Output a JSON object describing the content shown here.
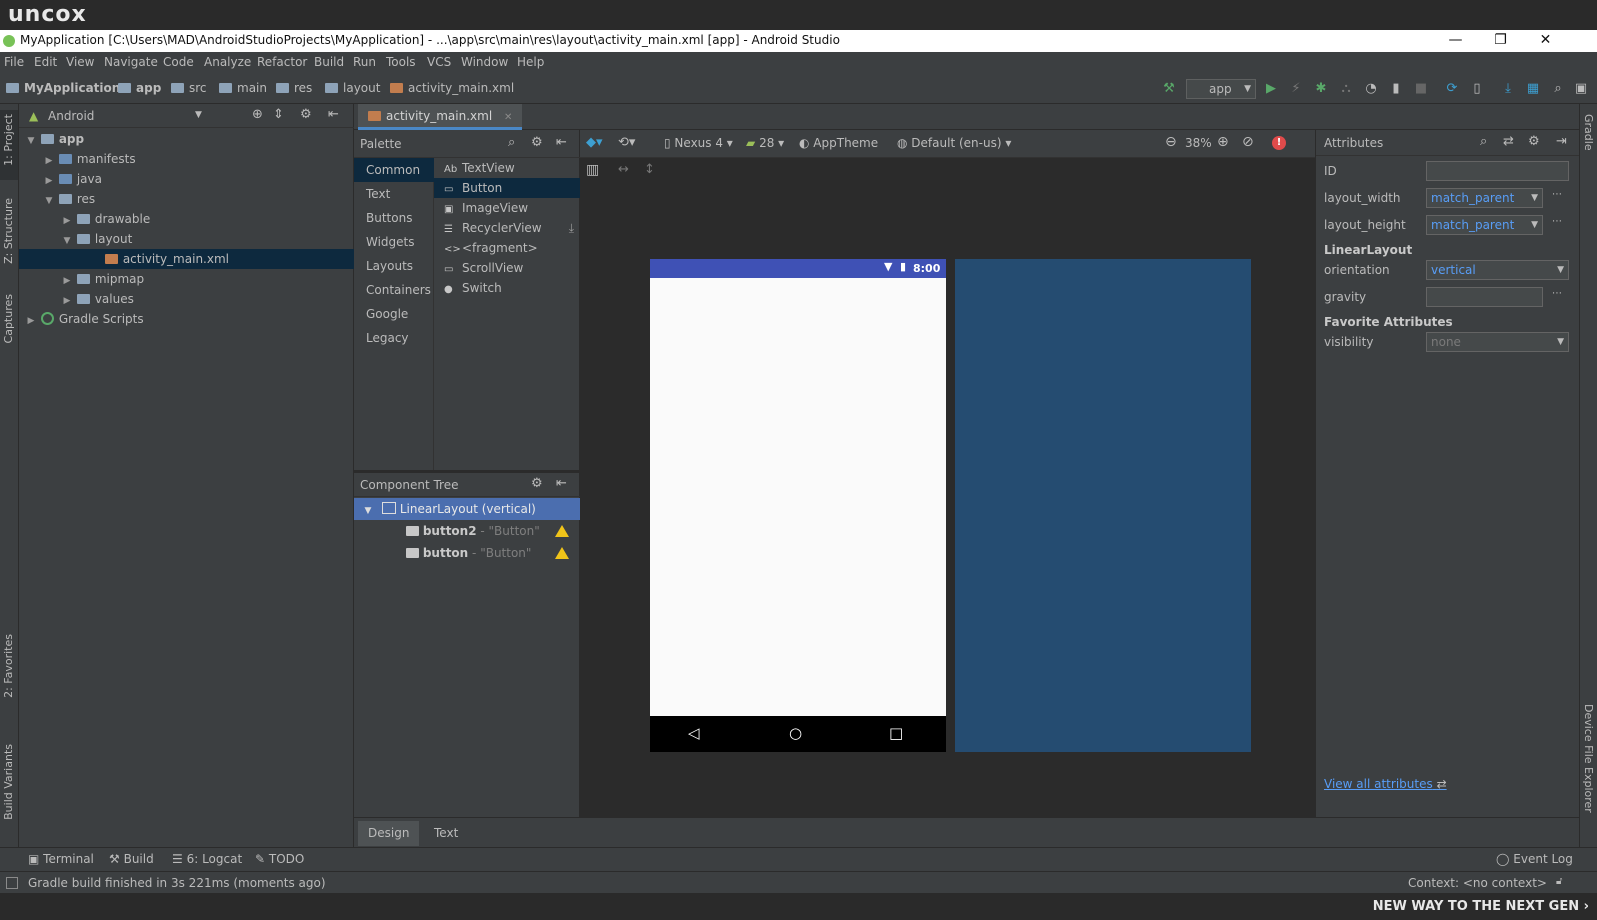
{
  "banner": {
    "logo": "uncox",
    "tagline": "NEW WAY TO THE NEXT GEN ›"
  },
  "window": {
    "title": "MyApplication [C:\\Users\\MAD\\AndroidStudioProjects\\MyApplication] - ...\\app\\src\\main\\res\\layout\\activity_main.xml [app] - Android Studio",
    "minimize": "—",
    "restore": "❐",
    "close": "✕"
  },
  "menu": [
    "File",
    "Edit",
    "View",
    "Navigate",
    "Code",
    "Analyze",
    "Refactor",
    "Build",
    "Run",
    "Tools",
    "VCS",
    "Window",
    "Help"
  ],
  "breadcrumbs": [
    "MyApplication",
    "app",
    "src",
    "main",
    "res",
    "layout",
    "activity_main.xml"
  ],
  "run_config": "app",
  "left_strip": [
    "1: Project",
    "Z: Structure",
    "Captures",
    "2: Favorites",
    "Build Variants"
  ],
  "project": {
    "view": "Android",
    "tree": [
      {
        "label": "app",
        "depth": 0,
        "expanded": true,
        "bold": true
      },
      {
        "label": "manifests",
        "depth": 1,
        "expanded": false
      },
      {
        "label": "java",
        "depth": 1,
        "expanded": false
      },
      {
        "label": "res",
        "depth": 1,
        "expanded": true
      },
      {
        "label": "drawable",
        "depth": 2,
        "expanded": false
      },
      {
        "label": "layout",
        "depth": 2,
        "expanded": true
      },
      {
        "label": "activity_main.xml",
        "depth": 3,
        "selected": true
      },
      {
        "label": "mipmap",
        "depth": 2,
        "expanded": false
      },
      {
        "label": "values",
        "depth": 2,
        "expanded": false
      },
      {
        "label": "Gradle Scripts",
        "depth": 0,
        "expanded": false
      }
    ]
  },
  "editor_tab": "activity_main.xml",
  "palette": {
    "title": "Palette",
    "categories": [
      "Common",
      "Text",
      "Buttons",
      "Widgets",
      "Layouts",
      "Containers",
      "Google",
      "Legacy"
    ],
    "items": [
      {
        "icon": "Ab",
        "label": "TextView"
      },
      {
        "icon": "▭",
        "label": "Button",
        "selected": true
      },
      {
        "icon": "▣",
        "label": "ImageView"
      },
      {
        "icon": "☰",
        "label": "RecyclerView"
      },
      {
        "icon": "<>",
        "label": "<fragment>"
      },
      {
        "icon": "▭",
        "label": "ScrollView"
      },
      {
        "icon": "●",
        "label": "Switch"
      }
    ]
  },
  "surface_toolbar": {
    "device": "Nexus 4",
    "api": "28",
    "theme": "AppTheme",
    "locale": "Default (en-us)",
    "zoom": "38%"
  },
  "phone": {
    "time": "8:00"
  },
  "component_tree": {
    "title": "Component Tree",
    "rows": [
      {
        "label": "LinearLayout (vertical)",
        "hint": "",
        "depth": 0,
        "selected": true
      },
      {
        "label": "button2",
        "hint": " - \"Button\"",
        "depth": 1,
        "warning": true
      },
      {
        "label": "button",
        "hint": " - \"Button\"",
        "depth": 1,
        "warning": true
      }
    ]
  },
  "attributes": {
    "title": "Attributes",
    "id_label": "ID",
    "id_value": "",
    "layout_width_label": "layout_width",
    "layout_width": "match_parent",
    "layout_height_label": "layout_height",
    "layout_height": "match_parent",
    "section1": "LinearLayout",
    "orientation_label": "orientation",
    "orientation": "vertical",
    "gravity_label": "gravity",
    "gravity": "",
    "section2": "Favorite Attributes",
    "visibility_label": "visibility",
    "visibility": "none",
    "view_all": "View all attributes"
  },
  "design_tabs": [
    "Design",
    "Text"
  ],
  "right_strip": [
    "Gradle",
    "Device File Explorer"
  ],
  "bottom_tools": [
    "Terminal",
    "Build",
    "6: Logcat",
    "TODO"
  ],
  "event_log": "Event Log",
  "status": {
    "message": "Gradle build finished in 3s 221ms (moments ago)",
    "context": "Context: <no context>"
  },
  "colors": {
    "accent": "#3f51b5",
    "blueprint": "#254c71",
    "selection": "#0d293e",
    "link": "#589df6",
    "warning": "#f0c419"
  }
}
